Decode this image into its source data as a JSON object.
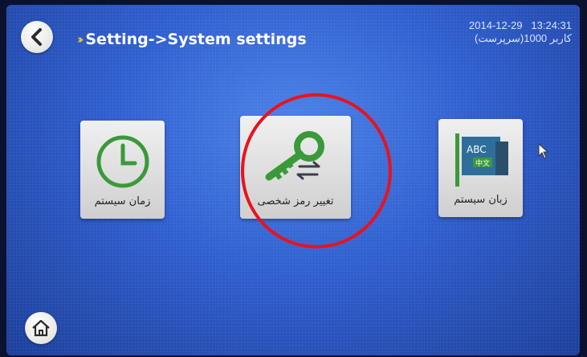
{
  "header": {
    "title": "Setting->System settings",
    "date": "2014-12-29",
    "time": "13:24:31",
    "user_line": "کاربر 1000(سرپرست)"
  },
  "tiles": [
    {
      "label": "زمان سیستم",
      "icon": "clock-icon"
    },
    {
      "label": "تغییر رمز شخصی",
      "icon": "key-icon"
    },
    {
      "label": "زبان سیستم",
      "icon": "language-flag-icon"
    }
  ],
  "colors": {
    "accent": "#f2c53a",
    "tile_icon": "#3a9a3a",
    "highlight": "#e8131d"
  }
}
